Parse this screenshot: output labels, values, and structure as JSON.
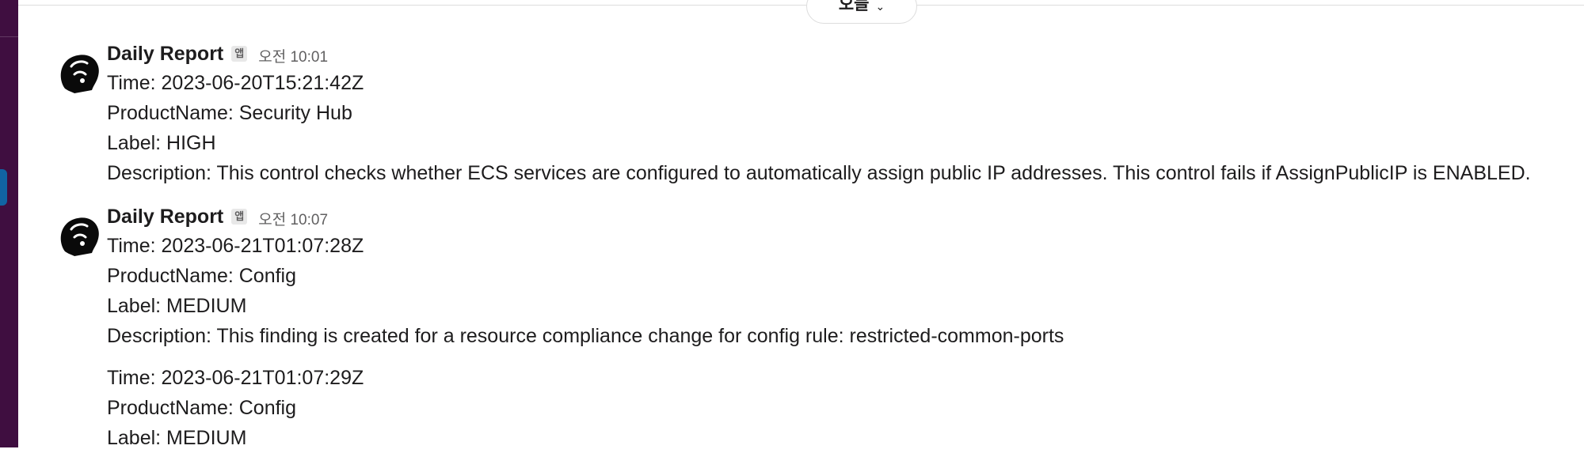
{
  "date_divider": {
    "label": "오늘"
  },
  "messages": [
    {
      "sender": "Daily Report",
      "badge": "앱",
      "time": "오전 10:01",
      "blocks": [
        {
          "time_line": "Time: 2023-06-20T15:21:42Z",
          "product_line": "ProductName: Security Hub",
          "label_line": "Label: HIGH",
          "description_line": "Description: This control checks whether ECS services are configured to automatically assign public IP addresses. This control fails if AssignPublicIP is ENABLED."
        }
      ]
    },
    {
      "sender": "Daily Report",
      "badge": "앱",
      "time": "오전 10:07",
      "blocks": [
        {
          "time_line": "Time: 2023-06-21T01:07:28Z",
          "product_line": "ProductName: Config",
          "label_line": "Label: MEDIUM",
          "description_line": "Description: This finding is created for a resource compliance change for config rule: restricted-common-ports"
        },
        {
          "time_line": "Time: 2023-06-21T01:07:29Z",
          "product_line": "ProductName: Config",
          "label_line": "Label: MEDIUM"
        }
      ]
    }
  ],
  "icons": {
    "avatar": "bald-head-avatar-icon",
    "chevron": "chevron-down-icon"
  },
  "colors": {
    "sidebar": "#3f0e40",
    "active_indicator": "#1164a3",
    "text": "#1d1c1d",
    "muted": "#616061"
  }
}
